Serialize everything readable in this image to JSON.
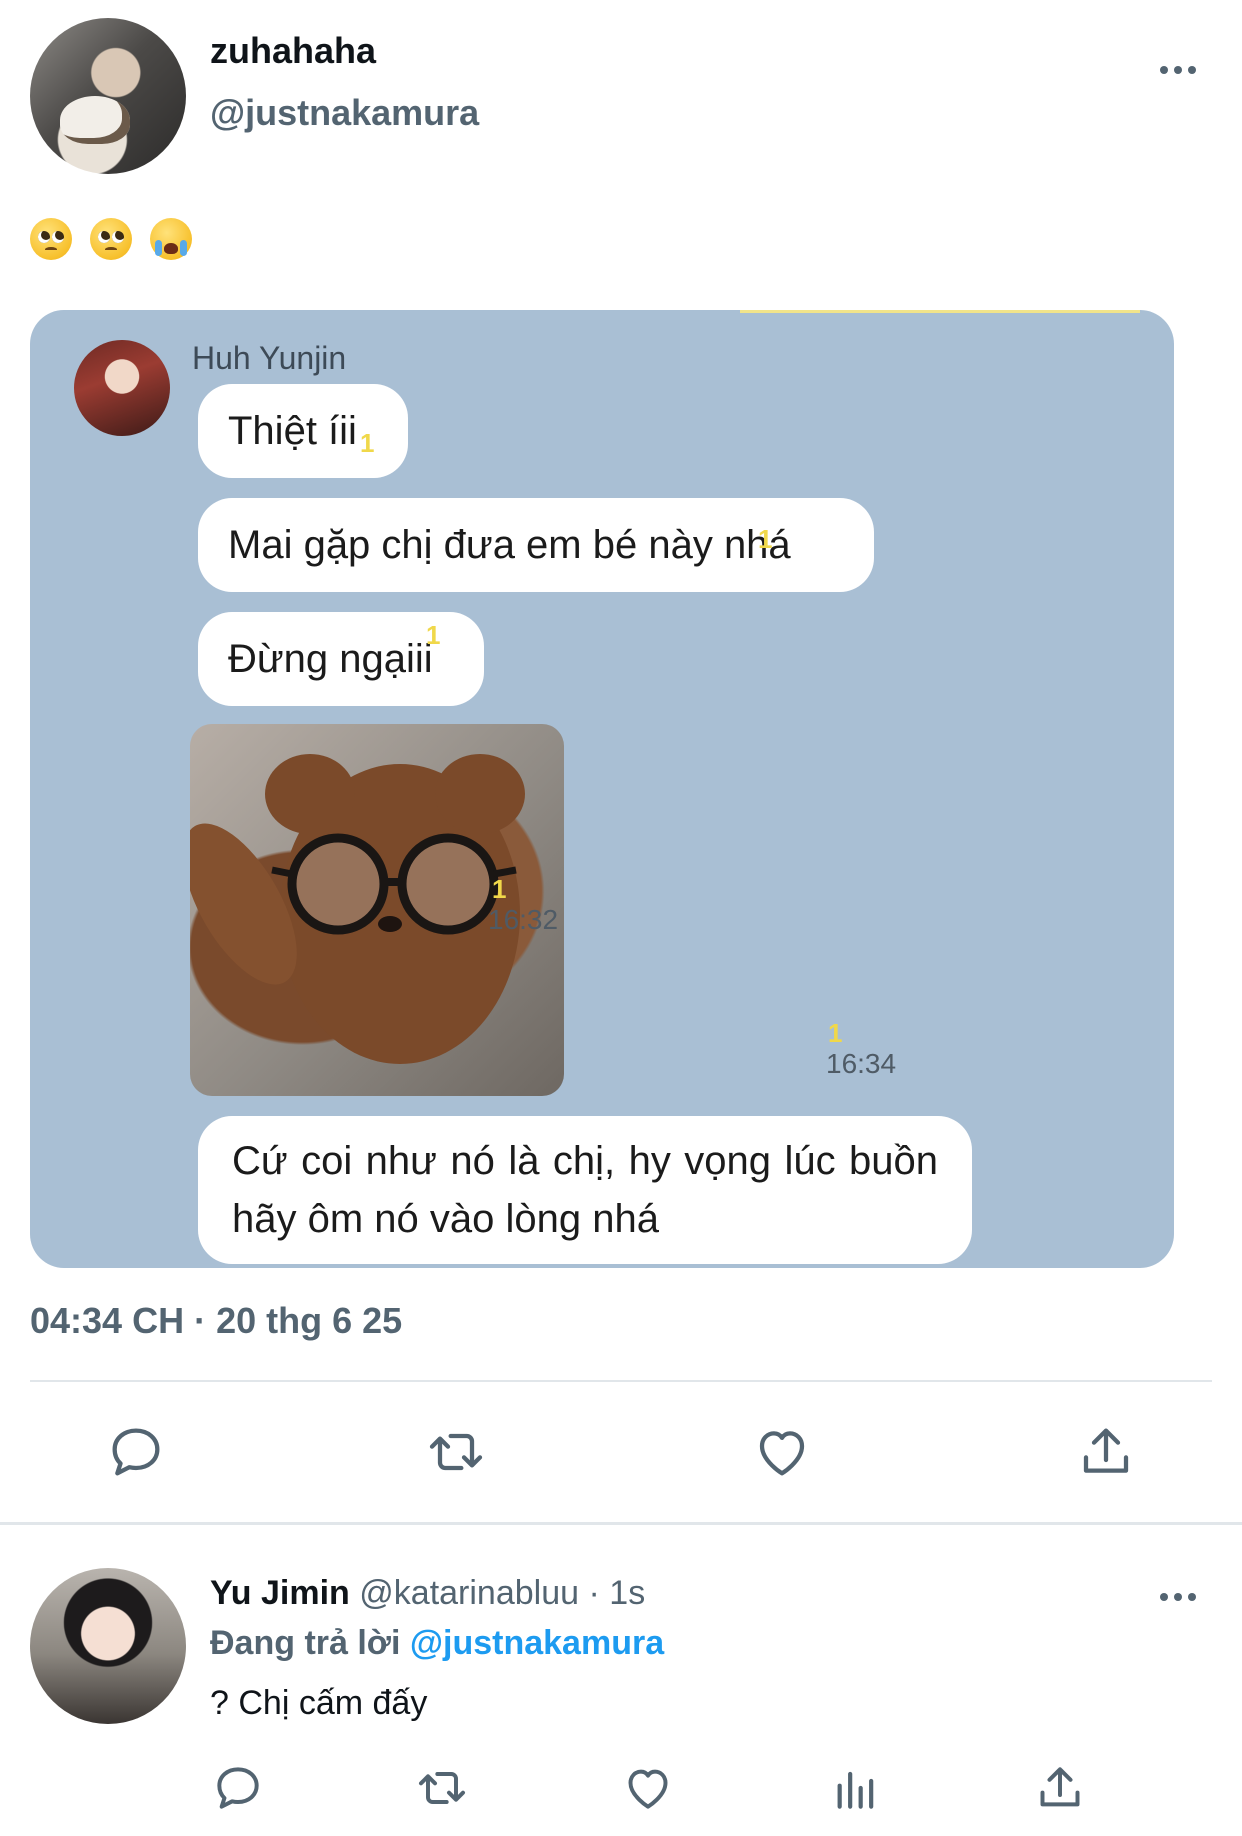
{
  "tweet": {
    "display_name": "zuhahaha",
    "handle": "@justnakamura",
    "emojis": [
      "pleading-face",
      "pleading-face",
      "loudly-crying-face"
    ],
    "timestamp": "04:34 CH · 20 thg 6 25"
  },
  "chat": {
    "sender": "Huh Yunjin",
    "messages": [
      {
        "text": "Thiệt íii",
        "read": "1"
      },
      {
        "text": "Mai gặp chị đưa em bé này nhá",
        "read": "1"
      },
      {
        "text": "Đừng ngạiii",
        "read": "1"
      },
      {
        "type": "image",
        "read": "1",
        "time": "16:32"
      },
      {
        "text": "Cứ coi như nó là chị, hy vọng lúc buồn hãy ôm nó vào lòng nhá",
        "read": "1",
        "time": "16:34"
      }
    ]
  },
  "actions": [
    "reply-icon",
    "retweet-icon",
    "like-icon",
    "share-icon"
  ],
  "reply": {
    "display_name": "Yu Jimin",
    "handle": "@katarinabluu",
    "dot": "·",
    "time": "1s",
    "replying_prefix": "Đang trả lời",
    "replying_to": "@justnakamura",
    "text": "? Chị cấm đấy",
    "actions": [
      "reply-icon",
      "retweet-icon",
      "like-icon",
      "views-icon",
      "share-icon"
    ]
  },
  "colors": {
    "text_primary": "#0f1419",
    "text_secondary": "#536471",
    "link": "#1d9bf0",
    "chat_background": "#a9bfd4",
    "read_marker": "#f0d84a"
  }
}
